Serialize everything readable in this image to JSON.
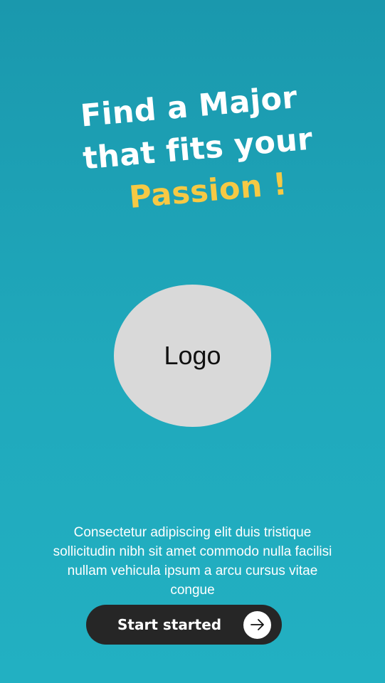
{
  "headline": {
    "line1": "Find a Major",
    "line2": "that fits your",
    "line3": "Passion !"
  },
  "logo": {
    "label": "Logo"
  },
  "description": "Consectetur adipiscing elit duis tristique sollicitudin nibh sit amet commodo nulla facilisi nullam vehicula ipsum a arcu cursus vitae congue",
  "cta": {
    "label": "Start started",
    "icon": "arrow-right-icon"
  },
  "colors": {
    "background_top": "#1a98ad",
    "background_bottom": "#22b0c2",
    "accent": "#f6c944",
    "button": "#262626",
    "logo_fill": "#d9d9d9"
  }
}
